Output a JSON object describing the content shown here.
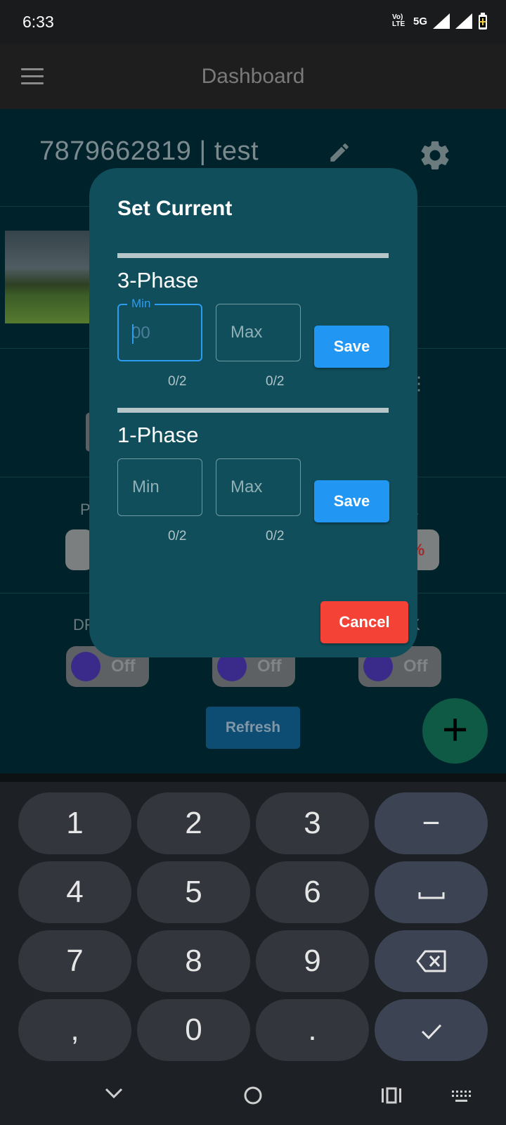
{
  "status_bar": {
    "time": "6:33",
    "volte": "Vo) LTE",
    "network": "5G"
  },
  "app_bar": {
    "title": "Dashboard"
  },
  "background": {
    "header_text": "7879662819 | test",
    "partial_left_label_1": "P",
    "partial_right_label_1": "L",
    "partial_left_label_2": "DR",
    "partial_right_label_2": "K",
    "percent_badge": "%",
    "toggles": [
      {
        "label": "Off"
      },
      {
        "label": "Off"
      },
      {
        "label": "Off"
      }
    ],
    "refresh_label": "Refresh",
    "fab_label": "+"
  },
  "dialog": {
    "title": "Set Current",
    "three_phase": {
      "title": "3-Phase",
      "min_label": "Min",
      "min_value": "00",
      "max_placeholder": "Max",
      "min_counter": "0/2",
      "max_counter": "0/2",
      "save_label": "Save"
    },
    "one_phase": {
      "title": "1-Phase",
      "min_placeholder": "Min",
      "max_placeholder": "Max",
      "min_counter": "0/2",
      "max_counter": "0/2",
      "save_label": "Save"
    },
    "cancel_label": "Cancel"
  },
  "keyboard": {
    "rows": [
      [
        "1",
        "2",
        "3",
        "−"
      ],
      [
        "4",
        "5",
        "6",
        "␣"
      ],
      [
        "7",
        "8",
        "9",
        "⌫"
      ],
      [
        ",",
        "0",
        ".",
        "✓"
      ]
    ]
  },
  "colors": {
    "dialog_bg": "#104e5b",
    "save": "#2196f3",
    "cancel": "#f44336",
    "focus": "#2d9bf0"
  }
}
